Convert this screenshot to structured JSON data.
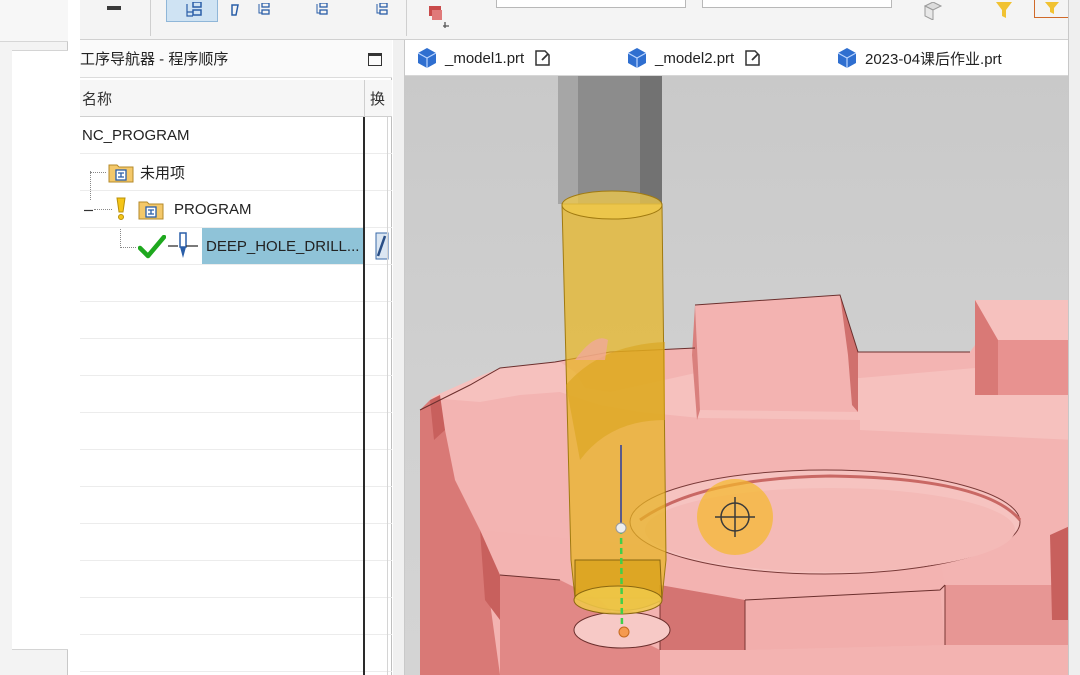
{
  "navigator": {
    "title": "工序导航器 - 程序顺序",
    "columns": {
      "name": "名称",
      "switch": "换"
    },
    "rows": [
      {
        "label": "NC_PROGRAM"
      },
      {
        "label": "未用项"
      },
      {
        "label": "PROGRAM"
      },
      {
        "label": "DEEP_HOLE_DRILL..."
      }
    ]
  },
  "tabs": [
    {
      "label": "_model1.prt"
    },
    {
      "label": "_model2.prt"
    },
    {
      "label": "2023-04课后作业.prt"
    }
  ],
  "colors": {
    "part": "#f2a6a4",
    "tool": "#e8b623",
    "selection": "#8fc3d8",
    "check": "#1ea81e"
  }
}
